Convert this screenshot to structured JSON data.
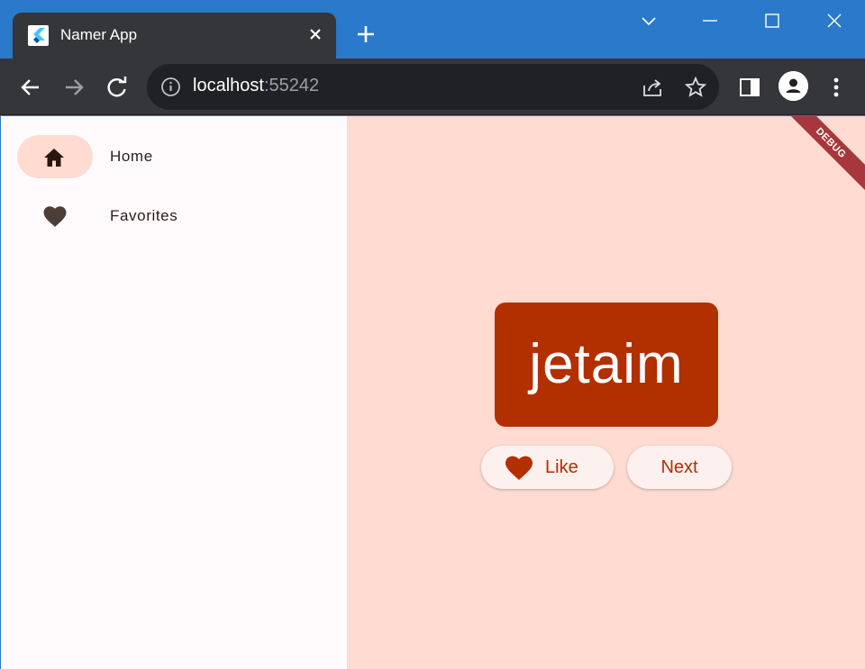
{
  "browser": {
    "tab_title": "Namer App",
    "url_host": "localhost",
    "url_port": ":55242"
  },
  "nav": {
    "items": [
      {
        "label": "Home",
        "icon": "home-icon",
        "selected": true
      },
      {
        "label": "Favorites",
        "icon": "favorite-icon",
        "selected": false
      }
    ]
  },
  "main": {
    "word": "jetaim",
    "like_label": "Like",
    "next_label": "Next",
    "debug_label": "DEBUG"
  },
  "colors": {
    "accent": "#b22f00",
    "background": "#ffdbd1",
    "rail": "#fffbfc",
    "titlebar": "#2a79cb"
  }
}
